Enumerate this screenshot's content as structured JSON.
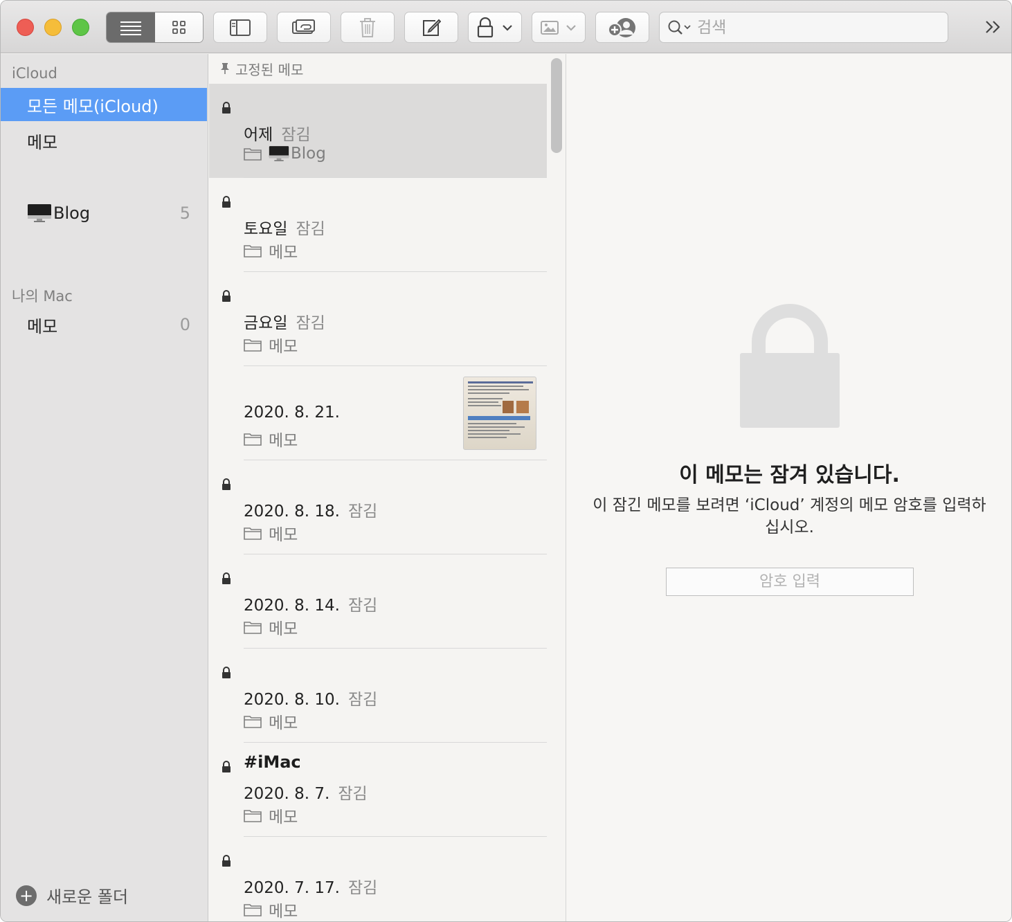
{
  "toolbar": {
    "search_placeholder": "검색"
  },
  "sidebar": {
    "icloud_header": "iCloud",
    "items_icloud": [
      {
        "label": "모든 메모(iCloud)",
        "count": ""
      },
      {
        "label": "메모",
        "count": ""
      },
      {
        "label": "Blog",
        "count": "5"
      }
    ],
    "mac_header": "나의 Mac",
    "items_mac": [
      {
        "label": "메모",
        "count": "0"
      }
    ],
    "new_folder_label": "새로운 폴더"
  },
  "notelist": {
    "pinned_header": "고정된 메모",
    "notes": [
      {
        "title": "",
        "date": "어제",
        "locked_label": "잠김",
        "folder": "Blog"
      },
      {
        "title": "",
        "date": "토요일",
        "locked_label": "잠김",
        "folder": "메모"
      },
      {
        "title": "",
        "date": "금요일",
        "locked_label": "잠김",
        "folder": "메모"
      },
      {
        "title": "",
        "date": "2020. 8. 21.",
        "locked_label": "",
        "folder": "메모"
      },
      {
        "title": "",
        "date": "2020. 8. 18.",
        "locked_label": "잠김",
        "folder": "메모"
      },
      {
        "title": "",
        "date": "2020. 8. 14.",
        "locked_label": "잠김",
        "folder": "메모"
      },
      {
        "title": "",
        "date": "2020. 8. 10.",
        "locked_label": "잠김",
        "folder": "메모"
      },
      {
        "title": "#iMac",
        "date": "2020. 8. 7.",
        "locked_label": "잠김",
        "folder": "메모"
      },
      {
        "title": "",
        "date": "2020. 7. 17.",
        "locked_label": "잠김",
        "folder": "메모"
      }
    ]
  },
  "detail": {
    "locked_title": "이 메모는 잠겨 있습니다.",
    "locked_desc": "이 잠긴 메모를 보려면 ‘iCloud’ 계정의 메모 암호를 입력하십시오.",
    "password_placeholder": "암호 입력"
  },
  "colors": {
    "selection_blue": "#5b9cf5",
    "close": "#ee5e55",
    "minimize": "#f5bd3a",
    "maximize": "#5ec546"
  }
}
